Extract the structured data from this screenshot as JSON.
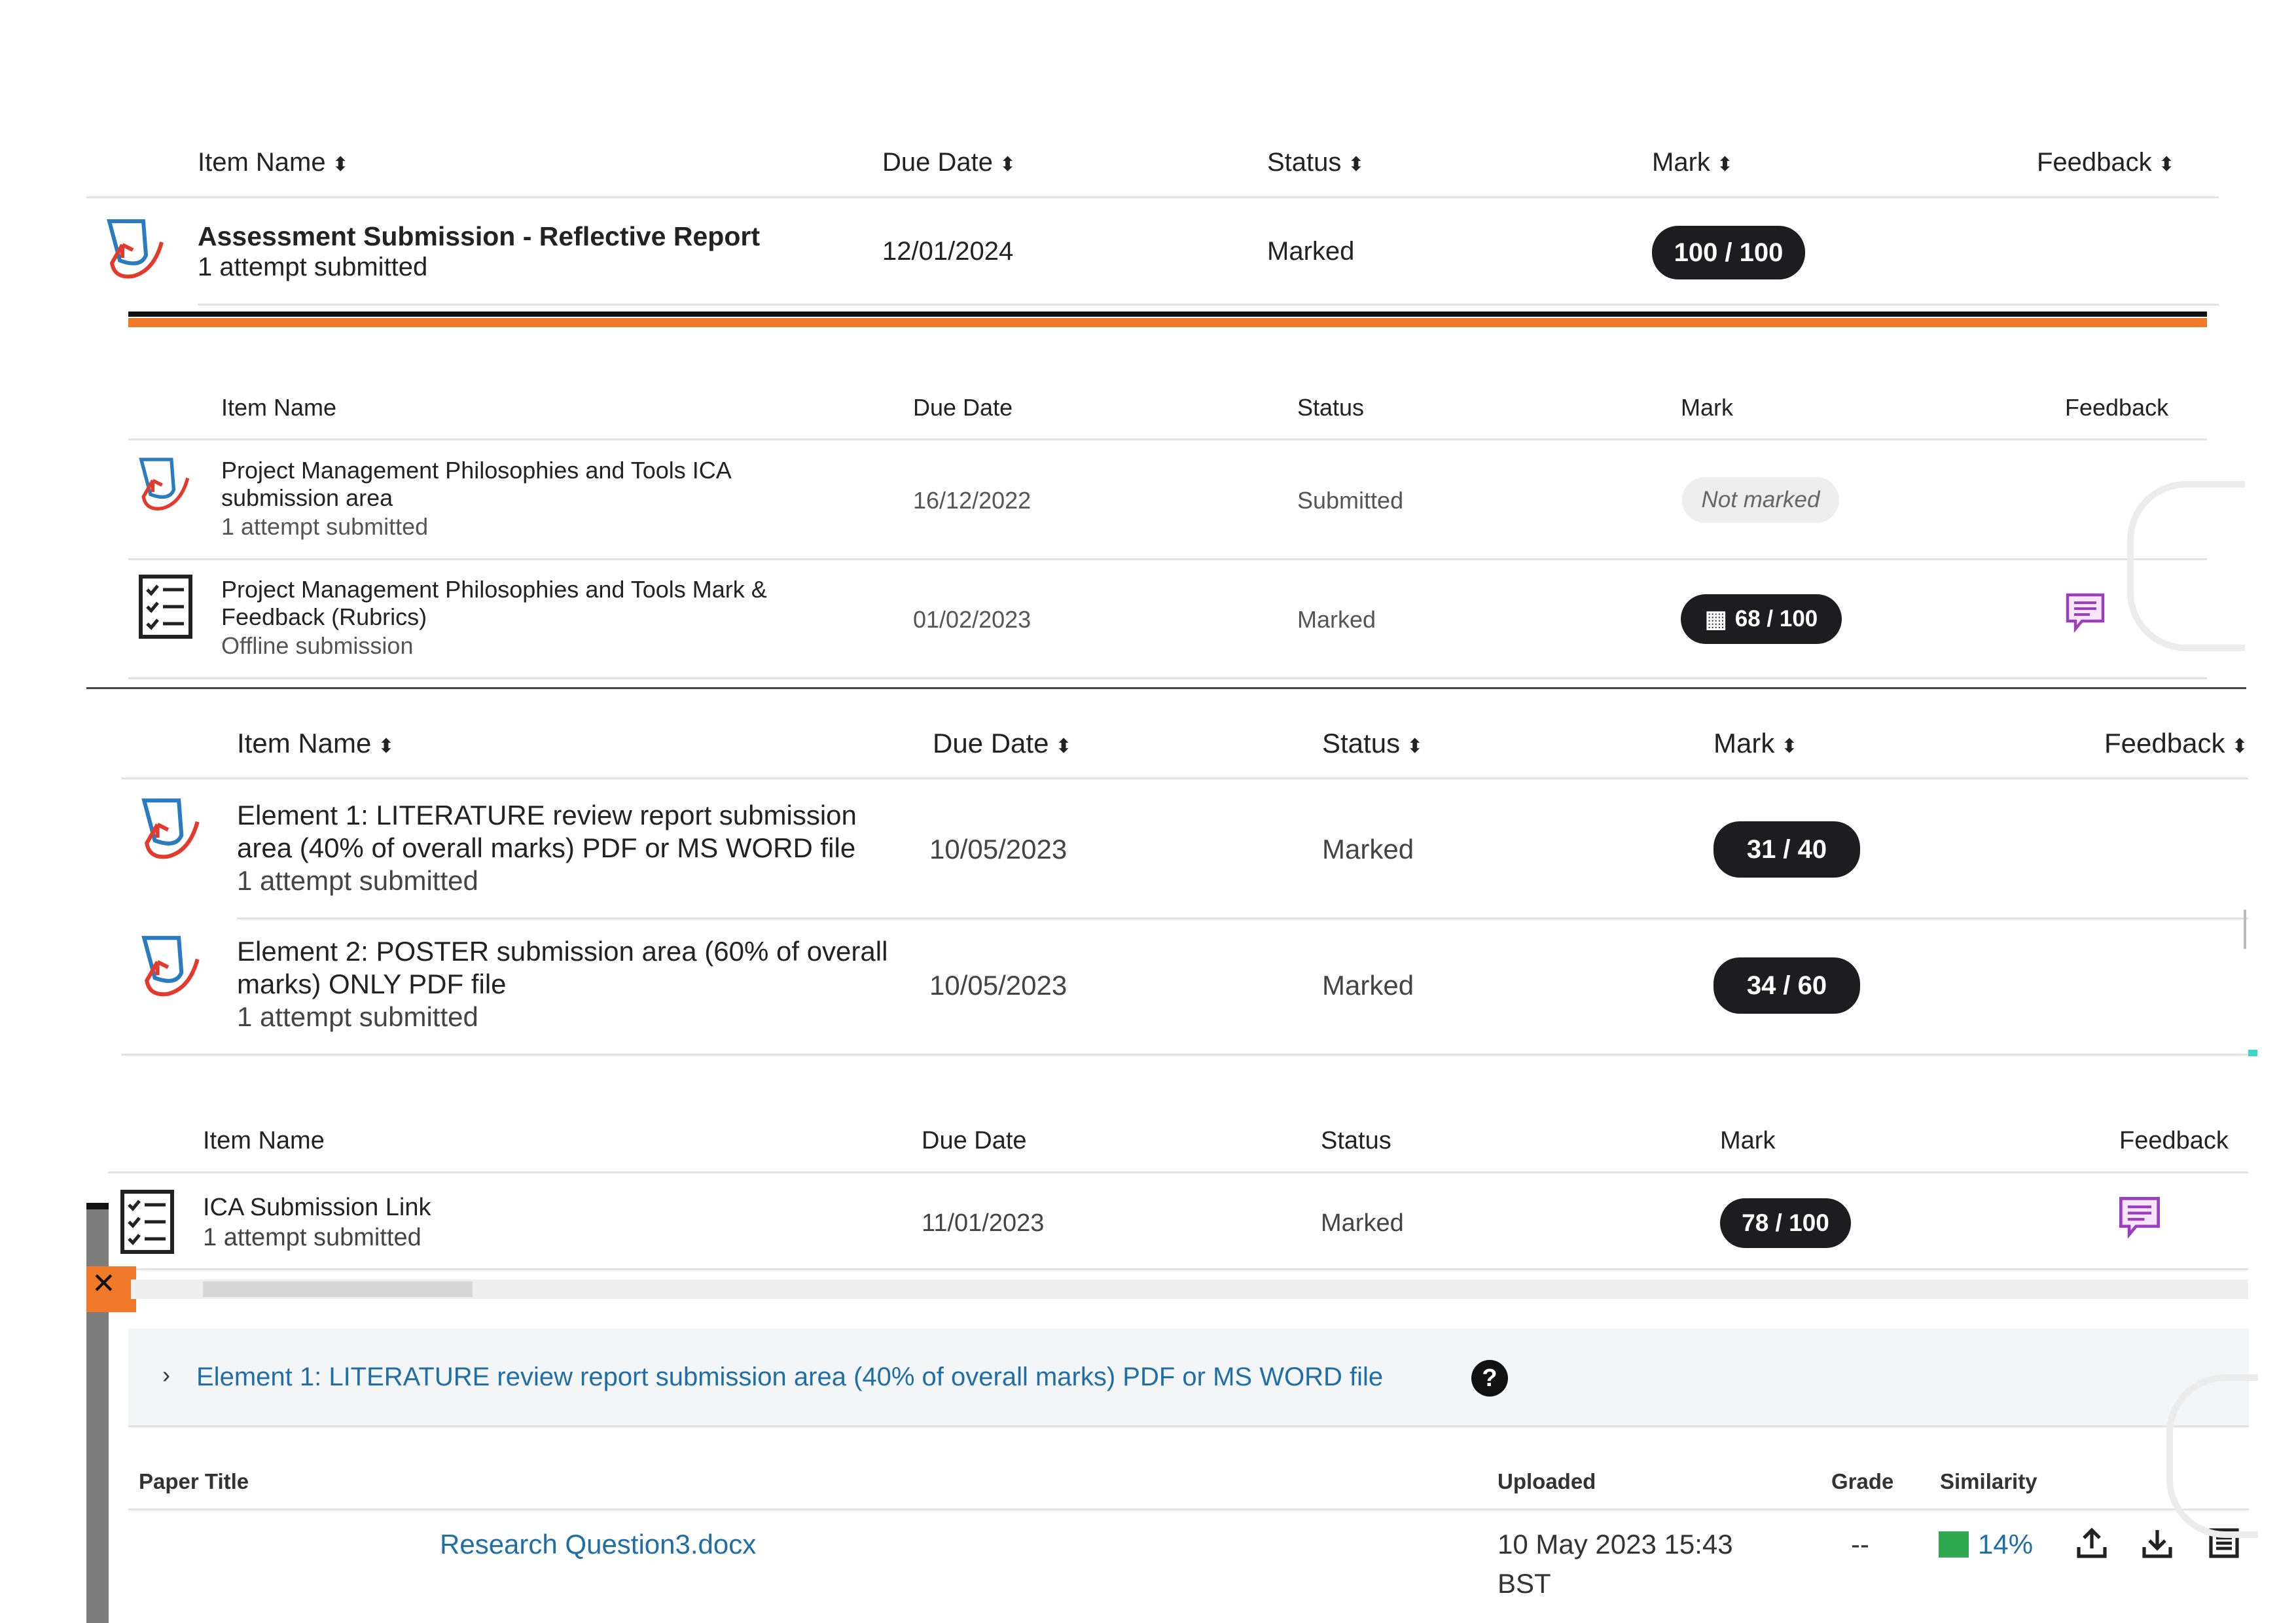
{
  "panel1": {
    "headers": {
      "item_name": "Item Name",
      "due_date": "Due Date",
      "status": "Status",
      "mark": "Mark",
      "feedback": "Feedback"
    },
    "rows": [
      {
        "title": "Assessment Submission - Reflective Report",
        "subtitle": "1 attempt submitted",
        "due": "12/01/2024",
        "status": "Marked",
        "mark": "100 / 100"
      }
    ]
  },
  "panel2": {
    "headers": {
      "item_name": "Item Name",
      "due_date": "Due Date",
      "status": "Status",
      "mark": "Mark",
      "feedback": "Feedback"
    },
    "rows": [
      {
        "title_line1": "Project Management Philosophies and Tools ICA",
        "title_line2": "submission area",
        "subtitle": "1 attempt submitted",
        "due": "16/12/2022",
        "status": "Submitted",
        "mark": "Not marked"
      },
      {
        "title_line1": "Project Management Philosophies and Tools Mark &",
        "title_line2": "Feedback (Rubrics)",
        "subtitle": "Offline submission",
        "due": "01/02/2023",
        "status": "Marked",
        "mark": "68 / 100"
      }
    ]
  },
  "panel3": {
    "headers": {
      "item_name": "Item Name",
      "due_date": "Due Date",
      "status": "Status",
      "mark": "Mark",
      "feedback": "Feedback"
    },
    "rows": [
      {
        "title_line1": "Element 1: LITERATURE review report submission",
        "title_line2": "area (40% of overall marks) PDF or MS WORD file",
        "subtitle": "1 attempt submitted",
        "due": "10/05/2023",
        "status": "Marked",
        "mark": "31 / 40"
      },
      {
        "title_line1": "Element 2: POSTER submission area (60% of overall",
        "title_line2": "marks) ONLY PDF file",
        "subtitle": "1 attempt submitted",
        "due": "10/05/2023",
        "status": "Marked",
        "mark": "34 / 60"
      }
    ]
  },
  "panel4": {
    "headers": {
      "item_name": "Item Name",
      "due_date": "Due Date",
      "status": "Status",
      "mark": "Mark",
      "feedback": "Feedback"
    },
    "rows": [
      {
        "title": "ICA Submission Link",
        "subtitle": "1 attempt submitted",
        "due": "11/01/2023",
        "status": "Marked",
        "mark": "78 / 100"
      }
    ]
  },
  "panel5": {
    "section_title": "Element 1: LITERATURE review report submission area (40% of overall marks) PDF or MS WORD file",
    "headers": {
      "paper_title": "Paper Title",
      "uploaded": "Uploaded",
      "grade": "Grade",
      "similarity": "Similarity"
    },
    "row": {
      "file": "Research Question3.docx",
      "uploaded_line1": "10 May 2023 15:43",
      "uploaded_line2": "BST",
      "grade": "--",
      "similarity": "14%"
    }
  },
  "colors": {
    "pill": "#1d1d1f",
    "accent_orange": "#f07a2a",
    "link": "#1f6fa6",
    "feedback_icon": "#9b3fc0",
    "similarity_green": "#2fa84f"
  },
  "icons": [
    "assignment-icon",
    "rubric-checklist-icon",
    "feedback-icon",
    "sort-icon",
    "help-icon",
    "upload-icon",
    "download-icon",
    "menu-icon",
    "chevron-right-icon",
    "close-icon"
  ]
}
